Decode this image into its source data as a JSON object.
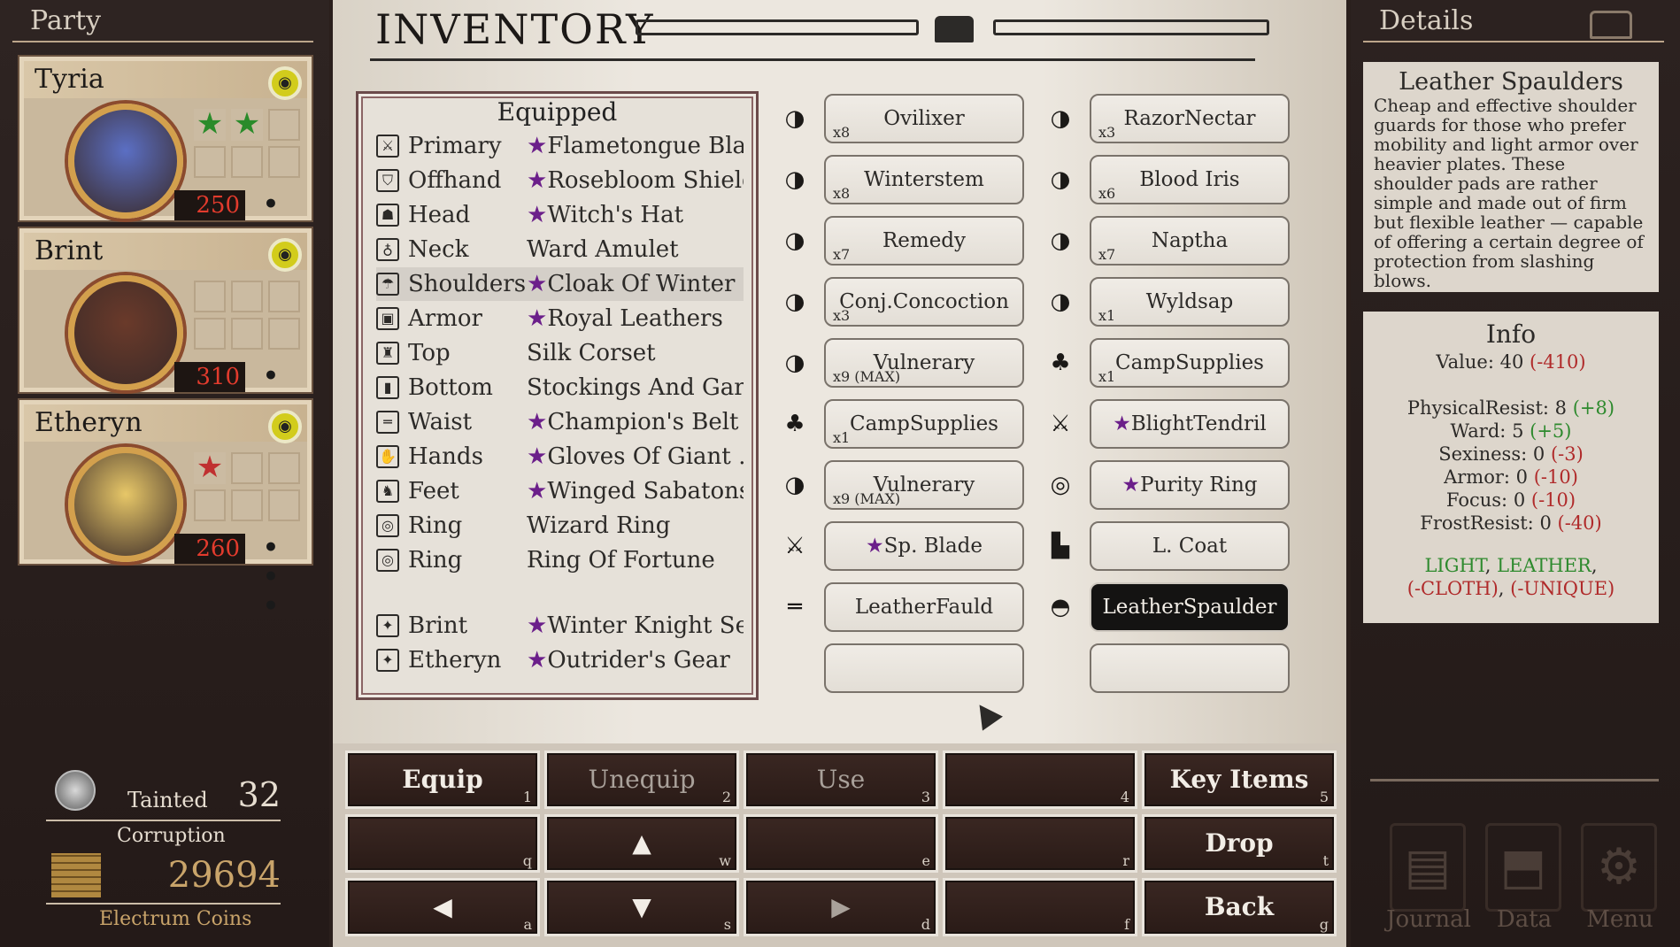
{
  "party": {
    "title": "Party",
    "members": [
      {
        "name": "Tyria",
        "hp": "250",
        "stars": 2,
        "star_color": "#2a8b2a"
      },
      {
        "name": "Brint",
        "hp": "310",
        "stars": 0,
        "star_color": "#2a8b2a"
      },
      {
        "name": "Etheryn",
        "hp": "260",
        "stars": 1,
        "star_color": "#c03030"
      }
    ],
    "more": "• • •",
    "corruption": {
      "status": "Tainted",
      "value": "32",
      "label": "Corruption"
    },
    "coins": {
      "value": "29694",
      "label": "Electrum Coins"
    }
  },
  "inventory": {
    "title": "INVENTORY",
    "equipped": {
      "title": "Equipped",
      "rows": [
        {
          "slot": "Primary",
          "item": "Flametongue Blade",
          "star": true
        },
        {
          "slot": "Offhand",
          "item": "Rosebloom Shield",
          "star": true
        },
        {
          "slot": "Head",
          "item": "Witch's Hat",
          "star": true
        },
        {
          "slot": "Neck",
          "item": "Ward Amulet",
          "star": false
        },
        {
          "slot": "Shoulders",
          "item": "Cloak Of Winter",
          "star": true
        },
        {
          "slot": "Armor",
          "item": "Royal Leathers",
          "star": true
        },
        {
          "slot": "Top",
          "item": "Silk Corset",
          "star": false
        },
        {
          "slot": "Bottom",
          "item": "Stockings And Gart…",
          "star": false
        },
        {
          "slot": "Waist",
          "item": "Champion's Belt",
          "star": true
        },
        {
          "slot": "Hands",
          "item": "Gloves Of Giant …",
          "star": true
        },
        {
          "slot": "Feet",
          "item": "Winged Sabatons",
          "star": true
        },
        {
          "slot": "Ring",
          "item": "Wizard Ring",
          "star": false
        },
        {
          "slot": "Ring",
          "item": "Ring Of Fortune",
          "star": false
        }
      ],
      "sets": [
        {
          "slot": "Brint",
          "item": "Winter Knight Set",
          "star": true
        },
        {
          "slot": "Etheryn",
          "item": "Outrider's Gear",
          "star": true
        }
      ]
    },
    "items_left": [
      {
        "name": "Ovilixer",
        "qty": "x8",
        "icon": "potion-icon"
      },
      {
        "name": "Winterstem",
        "qty": "x8",
        "icon": "potion-icon"
      },
      {
        "name": "Remedy",
        "qty": "x7",
        "icon": "potion-icon"
      },
      {
        "name": "Conj.Concoction",
        "qty": "x3",
        "icon": "potion-icon"
      },
      {
        "name": "Vulnerary",
        "qty": "x9 (MAX)",
        "icon": "potion-icon"
      },
      {
        "name": "CampSupplies",
        "qty": "x1",
        "icon": "sack-icon"
      },
      {
        "name": "Vulnerary",
        "qty": "x9 (MAX)",
        "icon": "potion-icon"
      },
      {
        "name": "Sp. Blade",
        "qty": "",
        "icon": "sword-icon",
        "star": true
      },
      {
        "name": "LeatherFauld",
        "qty": "",
        "icon": "belt-icon"
      },
      {
        "name": "",
        "qty": "",
        "icon": ""
      }
    ],
    "items_right": [
      {
        "name": "RazorNectar",
        "qty": "x3",
        "icon": "potion-icon"
      },
      {
        "name": "Blood Iris",
        "qty": "x6",
        "icon": "potion-icon"
      },
      {
        "name": "Naptha",
        "qty": "x7",
        "icon": "potion-icon"
      },
      {
        "name": "Wyldsap",
        "qty": "x1",
        "icon": "potion-icon"
      },
      {
        "name": "CampSupplies",
        "qty": "x1",
        "icon": "sack-icon"
      },
      {
        "name": "BlightTendril",
        "qty": "",
        "icon": "sword-icon",
        "star": true
      },
      {
        "name": "Purity Ring",
        "qty": "",
        "icon": "ring-icon",
        "star": true
      },
      {
        "name": "L. Coat",
        "qty": "",
        "icon": "armor-icon"
      },
      {
        "name": "LeatherSpaulder",
        "qty": "",
        "icon": "shoulder-icon",
        "selected": true
      },
      {
        "name": "",
        "qty": "",
        "icon": ""
      }
    ]
  },
  "details": {
    "title": "Details",
    "item_name": "Leather Spaulders",
    "description": "Cheap and effective shoulder guards for those who prefer mobility and light armor over heavier plates. These shoulder pads are rather simple and made out of firm but flexible leather — capable of offering a certain degree of protection from slashing blows.",
    "info_title": "Info",
    "value_line": {
      "label": "Value:",
      "value": "40",
      "delta": "(-410)"
    },
    "stats": [
      {
        "label": "PhysicalResist:",
        "value": "8",
        "delta": "(+8)",
        "positive": true
      },
      {
        "label": "Ward:",
        "value": "5",
        "delta": "(+5)",
        "positive": true
      },
      {
        "label": "Sexiness:",
        "value": "0",
        "delta": "(-3)",
        "positive": false
      },
      {
        "label": "Armor:",
        "value": "0",
        "delta": "(-10)",
        "positive": false
      },
      {
        "label": "Focus:",
        "value": "0",
        "delta": "(-10)",
        "positive": false
      },
      {
        "label": "FrostResist:",
        "value": "0",
        "delta": "(-40)",
        "positive": false
      }
    ],
    "tags_pos": [
      "LIGHT",
      "LEATHER"
    ],
    "tags_neg": [
      "(-CLOTH)",
      "(-UNIQUE)"
    ]
  },
  "commands": [
    {
      "label": "Equip",
      "key": "1",
      "dim": false
    },
    {
      "label": "Unequip",
      "key": "2",
      "dim": true
    },
    {
      "label": "Use",
      "key": "3",
      "dim": true
    },
    {
      "label": "",
      "key": "4",
      "dim": true
    },
    {
      "label": "Key Items",
      "key": "5",
      "dim": false
    },
    {
      "label": "",
      "key": "q",
      "dim": true
    },
    {
      "label": "▲",
      "key": "w",
      "dim": false
    },
    {
      "label": "",
      "key": "e",
      "dim": true
    },
    {
      "label": "",
      "key": "r",
      "dim": true
    },
    {
      "label": "Drop",
      "key": "t",
      "dim": false
    },
    {
      "label": "◀",
      "key": "a",
      "dim": false
    },
    {
      "label": "▼",
      "key": "s",
      "dim": false
    },
    {
      "label": "▶",
      "key": "d",
      "dim": true
    },
    {
      "label": "",
      "key": "f",
      "dim": true
    },
    {
      "label": "Back",
      "key": "g",
      "dim": false
    }
  ],
  "menu": [
    {
      "label": "Journal",
      "icon": "book-icon"
    },
    {
      "label": "Data",
      "icon": "bookmark-icon"
    },
    {
      "label": "Menu",
      "icon": "gear-icon"
    }
  ]
}
